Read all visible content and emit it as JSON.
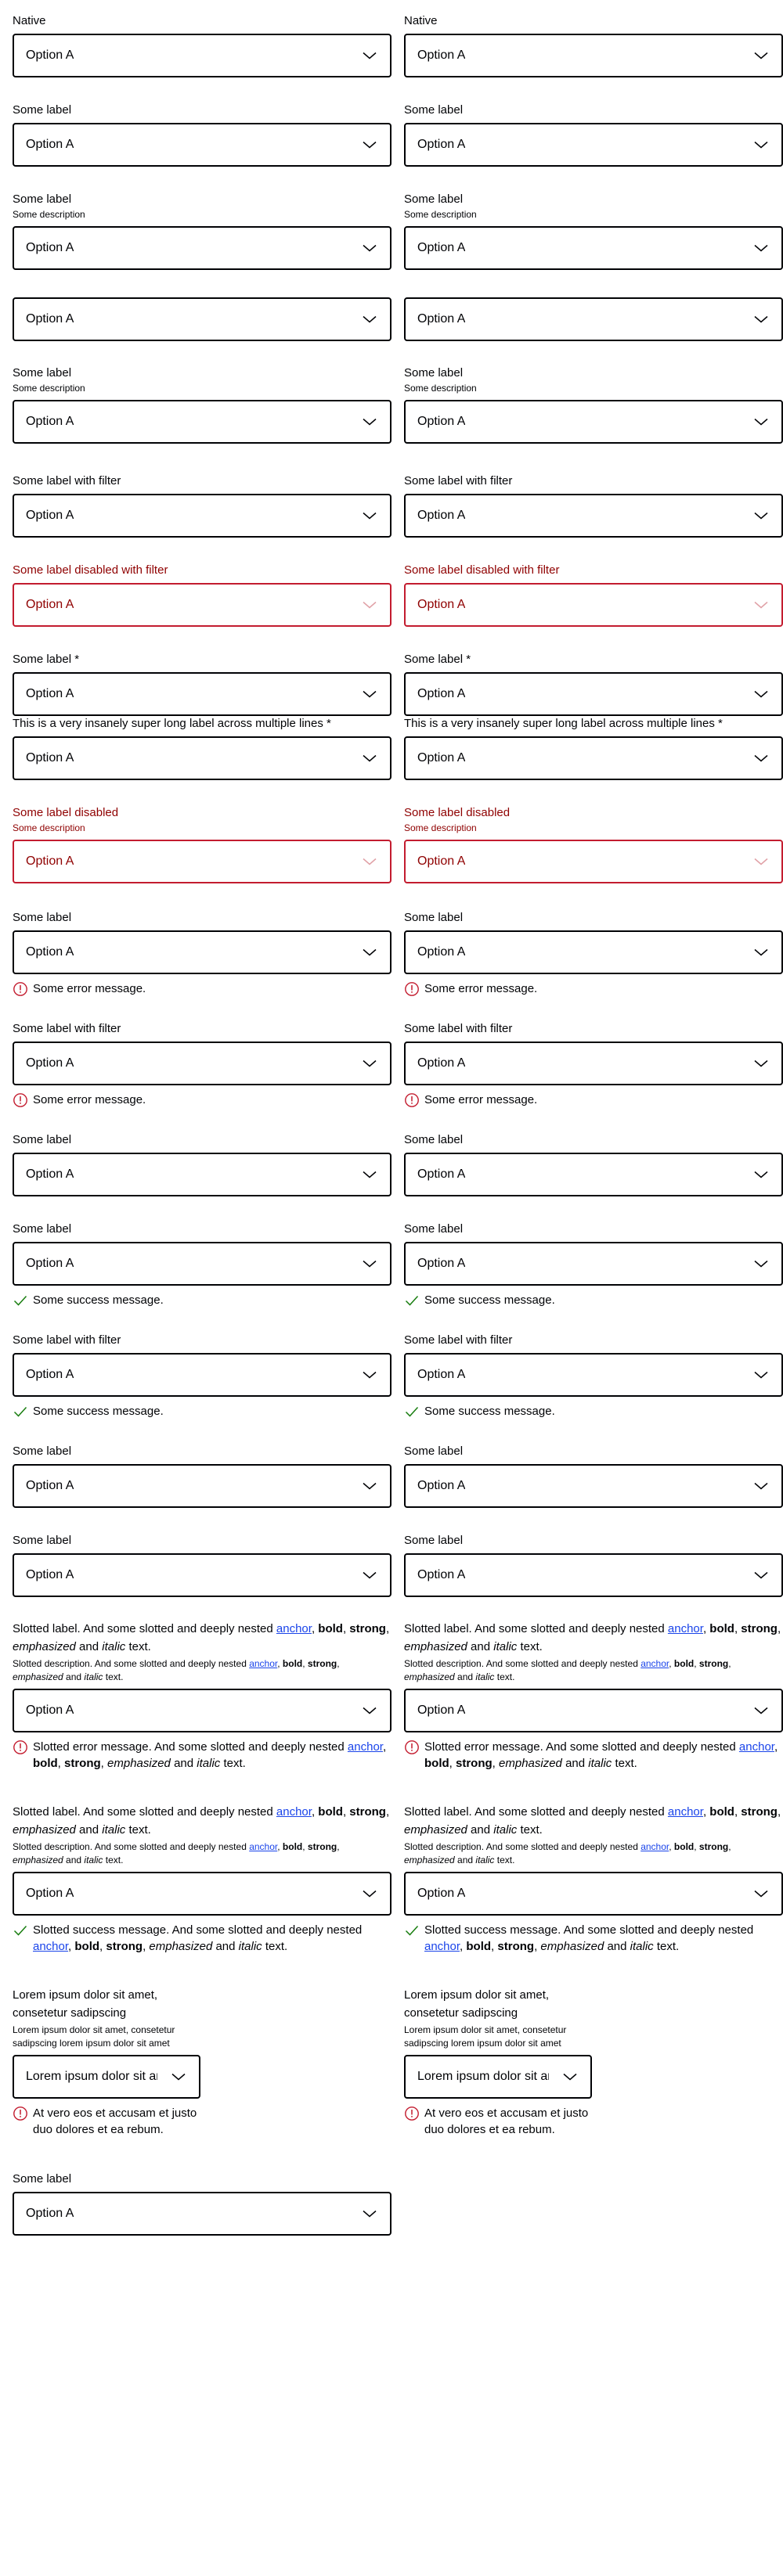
{
  "option": "Option A",
  "colors": {
    "border": "#010205",
    "disabled": "#8f0000",
    "error": "#c31c2f",
    "success": "#197e10",
    "link": "#1a44ea"
  },
  "icons": {
    "chevron": "chevron-down-icon",
    "error": "error-icon",
    "success": "check-icon"
  },
  "labels": {
    "native": "Native",
    "some_label": "Some label",
    "some_description": "Some description",
    "filter": "Some label with filter",
    "disabled_filter": "Some label disabled with filter",
    "required": "Some label *",
    "long_required": "This is a very insanely super long label across multiple lines *",
    "disabled": "Some label disabled",
    "error_msg": "Some error message.",
    "success_msg": "Some success message."
  },
  "slotted": {
    "label_prefix": "Slotted label. And some slotted and deeply nested ",
    "desc_prefix": "Slotted description. And some slotted and deeply nested ",
    "error_prefix": "Slotted error message. And some slotted and deeply nested ",
    "success_prefix": "Slotted success message. And some slotted and deeply nested ",
    "anchor": "anchor",
    "comma1": ", ",
    "bold": "bold",
    "comma2": ", ",
    "strong": "strong",
    "comma3": ", ",
    "emphasized": "emphasized",
    "and": " and ",
    "italic": "italic",
    "text_suffix": " text."
  },
  "lorem": {
    "label": "Lorem ipsum dolor sit amet, consetetur sadipscing",
    "desc": "Lorem ipsum dolor sit amet, consetetur sadipscing lorem ipsum dolor sit amet",
    "value": "Lorem ipsum dolor sit amet",
    "error": "At vero eos et accusam et justo duo dolores et ea rebum."
  }
}
